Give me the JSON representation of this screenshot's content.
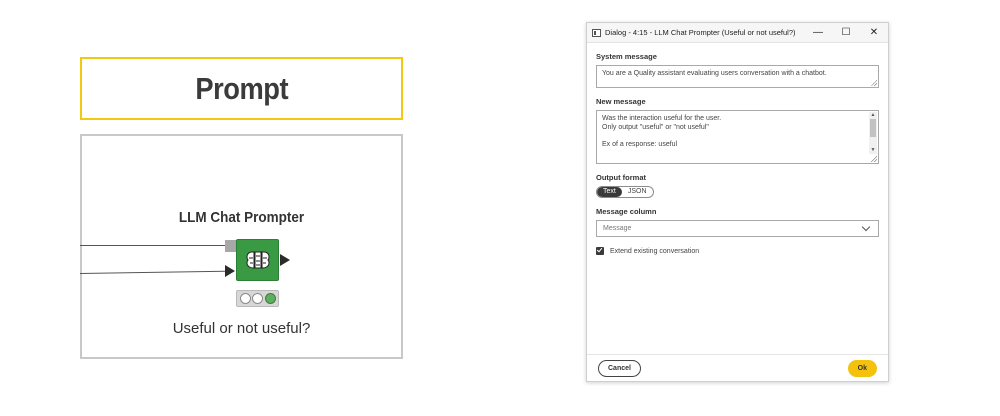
{
  "canvas": {
    "prompt_title": "Prompt",
    "node_title": "LLM Chat Prompter",
    "node_label": "Useful or not useful?",
    "node_icon": "brain-icon",
    "node_color": "#3a9a43",
    "frame_color": "#f2c811"
  },
  "dialog": {
    "title": "Dialog - 4:15 - LLM Chat Prompter (Useful or not useful?)",
    "system_message_label": "System message",
    "system_message_value": "You are a Quality assistant evaluating users conversation with a chatbot.",
    "new_message_label": "New message",
    "new_message_lines": [
      "Was the interaction useful for the user.",
      "Only output \"useful\" or \"not useful\"",
      "",
      "Ex of a response: useful"
    ],
    "output_format_label": "Output format",
    "output_format_options": [
      "Text",
      "JSON"
    ],
    "output_format_selected": "Text",
    "message_column_label": "Message column",
    "message_column_value": "Message",
    "extend_label": "Extend existing conversation",
    "extend_checked": true,
    "cancel_label": "Cancel",
    "ok_label": "Ok",
    "ok_color": "#f4c20d"
  }
}
